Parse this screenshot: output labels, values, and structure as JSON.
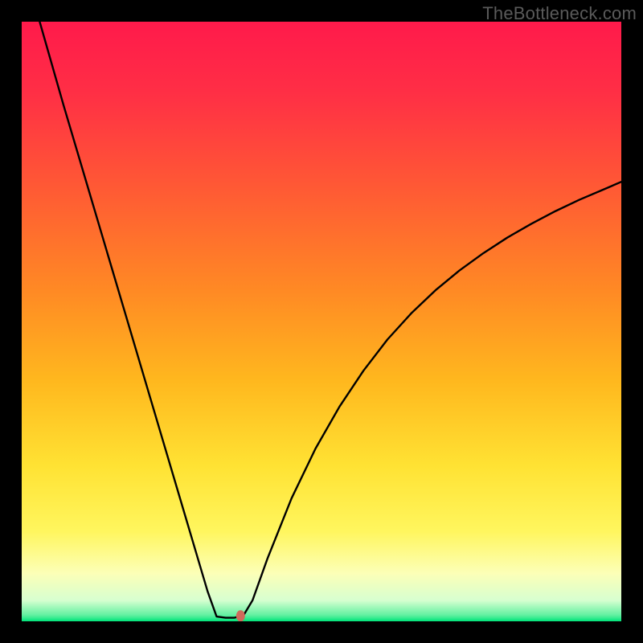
{
  "watermark": "TheBottleneck.com",
  "chart_data": {
    "type": "line",
    "title": "",
    "xlabel": "",
    "ylabel": "",
    "xlim": [
      0,
      100
    ],
    "ylim": [
      0,
      100
    ],
    "background_gradient_stops": [
      {
        "offset": 0,
        "color": "#ff1a4b"
      },
      {
        "offset": 0.12,
        "color": "#ff2f45"
      },
      {
        "offset": 0.28,
        "color": "#ff5a34"
      },
      {
        "offset": 0.45,
        "color": "#ff8a24"
      },
      {
        "offset": 0.6,
        "color": "#ffb81e"
      },
      {
        "offset": 0.74,
        "color": "#ffe233"
      },
      {
        "offset": 0.85,
        "color": "#fff65e"
      },
      {
        "offset": 0.92,
        "color": "#fcffb7"
      },
      {
        "offset": 0.965,
        "color": "#d7ffd0"
      },
      {
        "offset": 0.99,
        "color": "#60f0a0"
      },
      {
        "offset": 1.0,
        "color": "#00e47a"
      }
    ],
    "series": [
      {
        "name": "bottleneck-curve",
        "color": "#000000",
        "stroke_width": 2.4,
        "data": [
          {
            "x": 3.0,
            "y": 100.0
          },
          {
            "x": 7.0,
            "y": 86.0
          },
          {
            "x": 11.0,
            "y": 72.5
          },
          {
            "x": 15.0,
            "y": 59.0
          },
          {
            "x": 19.0,
            "y": 45.5
          },
          {
            "x": 23.0,
            "y": 32.0
          },
          {
            "x": 27.0,
            "y": 18.5
          },
          {
            "x": 31.0,
            "y": 5.0
          },
          {
            "x": 32.5,
            "y": 0.8
          },
          {
            "x": 34.0,
            "y": 0.6
          },
          {
            "x": 35.5,
            "y": 0.6
          },
          {
            "x": 37.0,
            "y": 1.0
          },
          {
            "x": 38.5,
            "y": 3.5
          },
          {
            "x": 41.0,
            "y": 10.5
          },
          {
            "x": 45.0,
            "y": 20.5
          },
          {
            "x": 49.0,
            "y": 28.8
          },
          {
            "x": 53.0,
            "y": 35.8
          },
          {
            "x": 57.0,
            "y": 41.8
          },
          {
            "x": 61.0,
            "y": 47.0
          },
          {
            "x": 65.0,
            "y": 51.4
          },
          {
            "x": 69.0,
            "y": 55.2
          },
          {
            "x": 73.0,
            "y": 58.5
          },
          {
            "x": 77.0,
            "y": 61.4
          },
          {
            "x": 81.0,
            "y": 64.0
          },
          {
            "x": 85.0,
            "y": 66.3
          },
          {
            "x": 89.0,
            "y": 68.4
          },
          {
            "x": 93.0,
            "y": 70.3
          },
          {
            "x": 97.0,
            "y": 72.0
          },
          {
            "x": 100.0,
            "y": 73.3
          }
        ]
      }
    ],
    "marker": {
      "x": 36.5,
      "y": 0.9,
      "rx": 5.5,
      "ry": 7.0,
      "color": "#cf6a5b"
    }
  }
}
